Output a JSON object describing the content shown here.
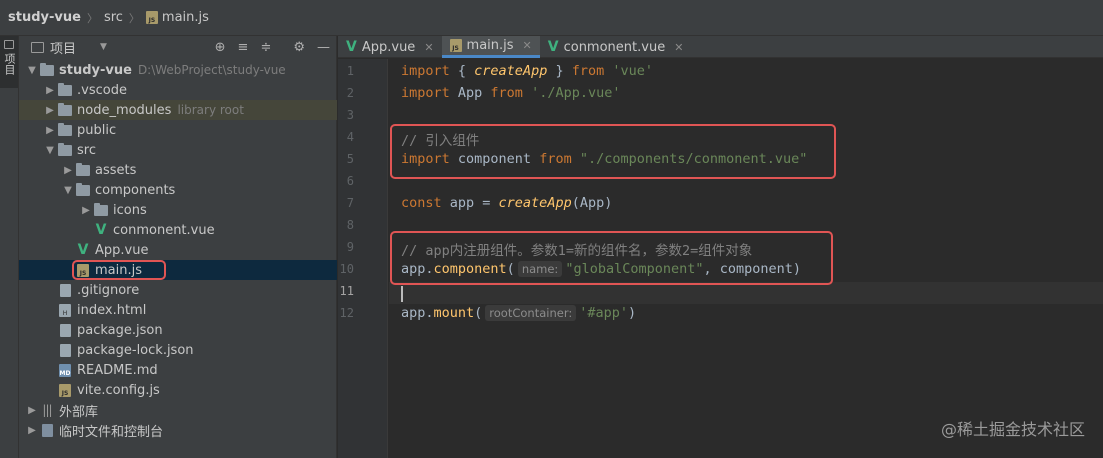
{
  "breadcrumb": {
    "project": "study-vue",
    "folder": "src",
    "file": "main.js"
  },
  "toolstrip": {
    "project_tab_label": "项目"
  },
  "panel": {
    "title": "项目"
  },
  "tree": [
    {
      "label": "study-vue",
      "path": "D:\\WebProject\\study-vue"
    },
    {
      "label": ".vscode"
    },
    {
      "label": "node_modules",
      "note": "library root"
    },
    {
      "label": "public"
    },
    {
      "label": "src"
    },
    {
      "label": "assets"
    },
    {
      "label": "components"
    },
    {
      "label": "icons"
    },
    {
      "label": "conmonent.vue"
    },
    {
      "label": "App.vue"
    },
    {
      "label": "main.js"
    },
    {
      "label": ".gitignore"
    },
    {
      "label": "index.html"
    },
    {
      "label": "package.json"
    },
    {
      "label": "package-lock.json"
    },
    {
      "label": "README.md"
    },
    {
      "label": "vite.config.js"
    },
    {
      "label": "外部库"
    },
    {
      "label": "临时文件和控制台"
    }
  ],
  "tabs": [
    {
      "label": "App.vue",
      "kind": "vue"
    },
    {
      "label": "main.js",
      "kind": "js",
      "active": true
    },
    {
      "label": "conmonent.vue",
      "kind": "vue"
    }
  ],
  "line_numbers": [
    "1",
    "2",
    "3",
    "4",
    "5",
    "6",
    "7",
    "8",
    "9",
    "10",
    "11",
    "12"
  ],
  "current_line": 11,
  "code": {
    "l1": {
      "kw1": "import",
      "p1": " { ",
      "fn": "createApp",
      "p2": " } ",
      "kw2": "from",
      "p3": " ",
      "str": "'vue'"
    },
    "l2": {
      "kw1": "import",
      "p1": " App ",
      "kw2": "from",
      "p2": " ",
      "str": "'./App.vue'"
    },
    "l4": {
      "cmt": "// 引入组件"
    },
    "l5": {
      "kw1": "import",
      "p1": " component ",
      "kw2": "from",
      "p2": " ",
      "str": "\"./components/conmonent.vue\""
    },
    "l7": {
      "kw": "const",
      "p1": " app = ",
      "fn": "createApp",
      "p2": "(App)"
    },
    "l9": {
      "cmt": "// app内注册组件。参数1=新的组件名，参数2=组件对象"
    },
    "l10": {
      "obj": "app.",
      "meth": "component",
      "p1": "(",
      "hint": "name:",
      "str": "\"globalComponent\"",
      "p2": ", component)"
    },
    "l12": {
      "obj": "app.",
      "meth": "mount",
      "p1": "(",
      "hint": "rootContainer:",
      "str": "'#app'",
      "p2": ")"
    }
  },
  "watermark": "@稀土掘金技术社区",
  "colors": {
    "highlight_box": "#e05554",
    "vue_icon": "#3fb27f",
    "active_tab_underline": "#4a88c7"
  }
}
